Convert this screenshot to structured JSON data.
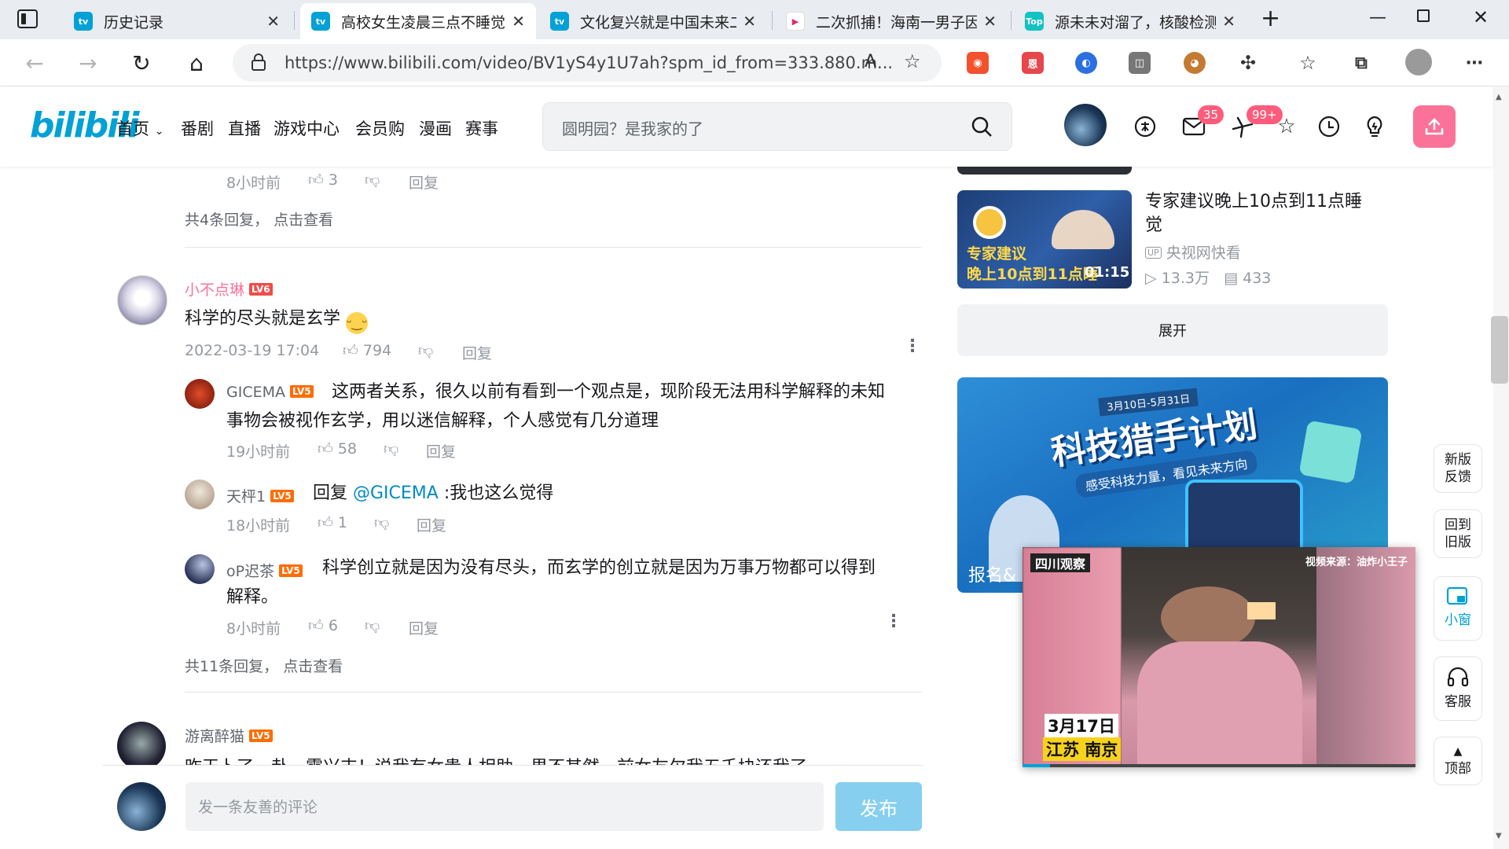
{
  "browser": {
    "tabs": [
      {
        "title": "历史记录",
        "icon": "bilibili-tv-icon"
      },
      {
        "title": "高校女生凌晨三点不睡觉",
        "icon": "bilibili-tv-icon"
      },
      {
        "title": "文化复兴就是中国未来二",
        "icon": "bilibili-tv-icon"
      },
      {
        "title": "二次抓捕！海南一男子因",
        "icon": "play-icon"
      },
      {
        "title": "源未未对溜了，核酸检测",
        "icon": "top-icon"
      }
    ],
    "url": "https://www.bilibili.com/video/BV1yS4y1U7ah?spm_id_from=333.880.m...",
    "read_aloud": "A",
    "ext_labels": [
      "恩"
    ]
  },
  "header": {
    "logo": "bilibili",
    "nav": [
      "首页",
      "番剧",
      "直播",
      "游戏中心",
      "会员购",
      "漫画",
      "赛事"
    ],
    "search_placeholder": "圆明园？是我家的了",
    "badge_messages": "35",
    "badge_dynamics": "99+"
  },
  "comments": {
    "prev_reply_time": "8小时前",
    "prev_reply_likes": "3",
    "prev_reply_label": "回复",
    "prev_total": "共4条回复，",
    "prev_view": "点击查看",
    "main": {
      "user": "小不点琳",
      "level": "LV6",
      "text": "科学的尽头就是玄学",
      "time": "2022-03-19 17:04",
      "likes": "794",
      "reply_label": "回复"
    },
    "replies": [
      {
        "user": "GICEMA",
        "level": "LV5",
        "text": "这两者关系，很久以前有看到一个观点是，现阶段无法用科学解释的未知",
        "text2": "事物会被视作玄学，用以迷信解释，个人感觉有几分道理",
        "time": "19小时前",
        "likes": "58",
        "reply_label": "回复"
      },
      {
        "user": "天枰1",
        "level": "LV5",
        "prefix": "回复 ",
        "mention": "@GICEMA",
        "text": " :我也这么觉得",
        "time": "18小时前",
        "likes": "1",
        "reply_label": "回复"
      },
      {
        "user": "oP迟茶",
        "level": "LV5",
        "text": "科学创立就是因为没有尽头，而玄学的创立就是因为万事万物都可以得到",
        "text2": "解释。",
        "time": "8小时前",
        "likes": "6",
        "reply_label": "回复"
      }
    ],
    "total": "共11条回复，",
    "view": "点击查看",
    "next": {
      "user": "游离醉猫",
      "level": "LV5",
      "text": "昨天卜了一卦，震兴支！说我有女贵人相助，果不其然，前女友欠我五千块还我了"
    }
  },
  "right": {
    "rec": {
      "title_line1": "专家建议晚上10点到11点睡",
      "title_line2": "觉",
      "up_tag": "UP",
      "uploader": "央视网快看",
      "views": "13.3万",
      "danmaku": "433",
      "duration": "01:15",
      "thumb_caption1": "专家建议",
      "thumb_caption2": "晚上10点到11点睡"
    },
    "expand": "展开",
    "banner_title": "科技猎手计划",
    "banner_sub": "感受科技力量，看见未来方向",
    "banner_date": "3月10日-5月31日",
    "banner_cta": "报名&",
    "mini_player": {
      "tag_left": "四川观察",
      "tag_right": "视频来源：油炸小王子",
      "date": "3月17日",
      "place": "江苏 南京"
    }
  },
  "side": {
    "feedback": [
      "新版",
      "反馈"
    ],
    "old": [
      "回到",
      "旧版"
    ],
    "mini": "小窗",
    "service": "客服",
    "top": "顶部"
  },
  "replybar": {
    "placeholder": "发一条友善的评论",
    "send": "发布"
  }
}
